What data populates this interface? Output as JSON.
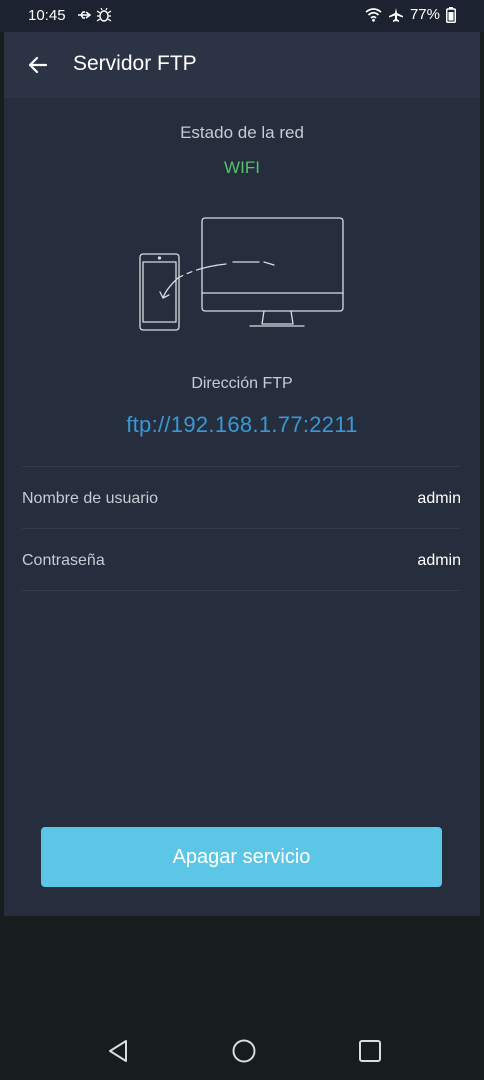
{
  "status_bar": {
    "time": "10:45",
    "battery": "77%",
    "icons": [
      "usb-icon",
      "debug-icon",
      "wifi-icon",
      "airplane-icon",
      "battery-icon"
    ]
  },
  "toolbar": {
    "title": "Servidor FTP",
    "back_icon": "back-arrow-icon"
  },
  "network": {
    "label": "Estado de la red",
    "value": "WIFI",
    "value_color": "#52c46a"
  },
  "illustration": {
    "icon": "phone-to-computer-transfer-illustration"
  },
  "ftp": {
    "label": "Dirección FTP",
    "address": "ftp://192.168.1.77:2211",
    "address_color": "#3a98d6"
  },
  "credentials": [
    {
      "label": "Nombre de usuario",
      "value": "admin"
    },
    {
      "label": "Contraseña",
      "value": "admin"
    }
  ],
  "action": {
    "button_label": "Apagar servicio",
    "button_color": "#5bc6e6"
  },
  "nav_bar": {
    "icons": [
      "nav-back-icon",
      "nav-home-icon",
      "nav-recents-icon"
    ]
  }
}
